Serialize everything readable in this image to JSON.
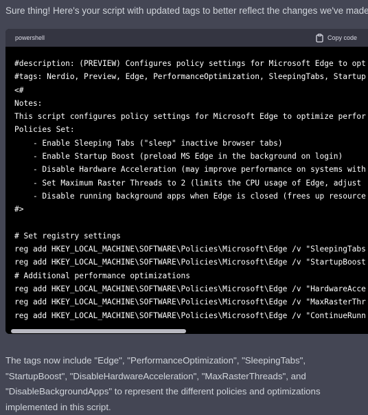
{
  "intro_text": "Sure thing! Here's your script with updated tags to better reflect the changes we've made:",
  "code_block": {
    "language": "powershell",
    "copy_label": "Copy code",
    "lines": [
      "#description: (PREVIEW) Configures policy settings for Microsoft Edge to opt",
      "#tags: Nerdio, Preview, Edge, PerformanceOptimization, SleepingTabs, Startup",
      "<#",
      "Notes:",
      "This script configures policy settings for Microsoft Edge to optimize perfor",
      "Policies Set:",
      "    - Enable Sleeping Tabs (\"sleep\" inactive browser tabs)",
      "    - Enable Startup Boost (preload MS Edge in the background on login)",
      "    - Disable Hardware Acceleration (may improve performance on systems with",
      "    - Set Maximum Raster Threads to 2 (limits the CPU usage of Edge, adjust",
      "    - Disable running background apps when Edge is closed (frees up resource",
      "#>",
      "",
      "# Set registry settings",
      "reg add HKEY_LOCAL_MACHINE\\SOFTWARE\\Policies\\Microsoft\\Edge /v \"SleepingTabs",
      "reg add HKEY_LOCAL_MACHINE\\SOFTWARE\\Policies\\Microsoft\\Edge /v \"StartupBoost",
      "# Additional performance optimizations",
      "reg add HKEY_LOCAL_MACHINE\\SOFTWARE\\Policies\\Microsoft\\Edge /v \"HardwareAcce",
      "reg add HKEY_LOCAL_MACHINE\\SOFTWARE\\Policies\\Microsoft\\Edge /v \"MaxRasterThr",
      "reg add HKEY_LOCAL_MACHINE\\SOFTWARE\\Policies\\Microsoft\\Edge /v \"ContinueRunn"
    ]
  },
  "outro_text": "The tags now include \"Edge\", \"PerformanceOptimization\", \"SleepingTabs\", \"StartupBoost\", \"DisableHardwareAcceleration\", \"MaxRasterThreads\", and \"DisableBackgroundApps\" to represent the different policies and optimizations implemented in this script.",
  "icons": {
    "copy": "clipboard-icon"
  },
  "colors": {
    "page_background": "#444654",
    "code_background": "#000000",
    "code_header_background": "#343541",
    "text": "#d1d5db"
  }
}
